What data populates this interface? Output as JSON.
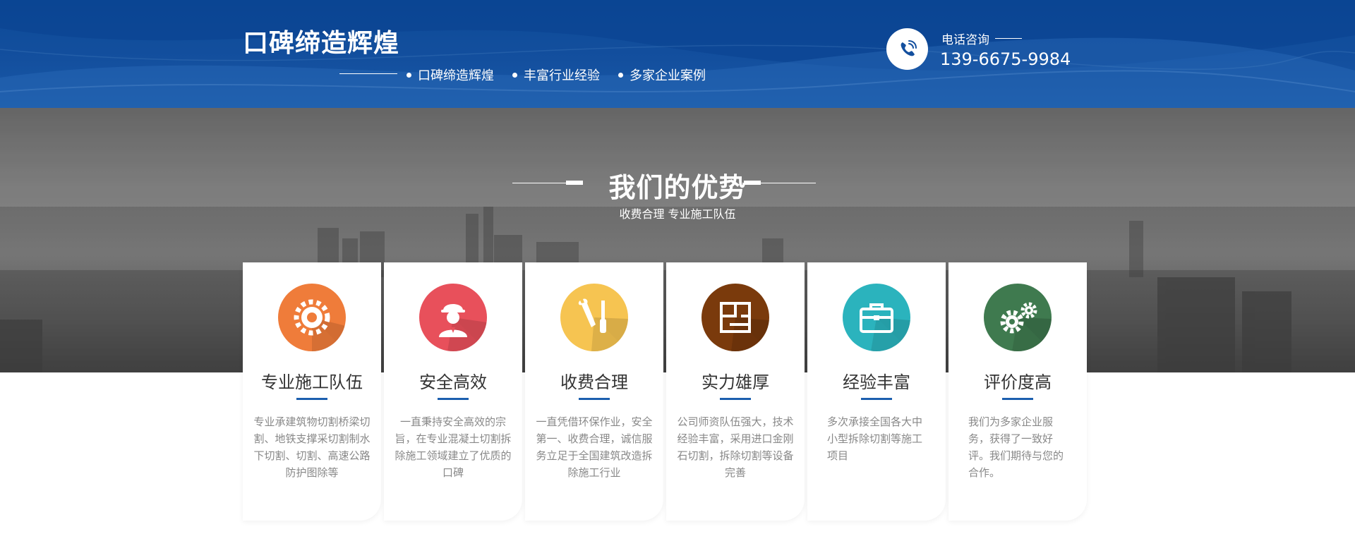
{
  "header": {
    "brand": "口碑缔造辉煌",
    "taglines": [
      "口碑缔造辉煌",
      "丰富行业经验",
      "多家企业案例"
    ],
    "phone_label": "电话咨询",
    "phone_number": "139-6675-9984",
    "phone_icon": "phone-icon"
  },
  "section": {
    "title": "我们的优势",
    "subtitle": "收费合理 专业施工队伍"
  },
  "cards": [
    {
      "title": "专业施工队伍",
      "desc": "专业承建筑物切割桥梁切割、地铁支撑采切割制水下切割、切割、高速公路防护图除等",
      "icon": "gear-icon",
      "color": "#ef7c3a"
    },
    {
      "title": "安全高效",
      "desc": "一直秉持安全高效的宗旨，在专业混凝土切割拆除施工领域建立了优质的口碑",
      "icon": "worker-helmet-icon",
      "color": "#e8505b"
    },
    {
      "title": "收费合理",
      "desc": "一直凭借环保作业，安全第一、收费合理，诚信服务立足于全国建筑改造拆除施工行业",
      "icon": "wrench-screwdriver-icon",
      "color": "#f6c451"
    },
    {
      "title": "实力雄厚",
      "desc": "公司师资队伍强大，技术经验丰富，采用进口金刚石切割，拆除切割等设备完善",
      "icon": "layout-icon",
      "color": "#7a3a0c"
    },
    {
      "title": "经验丰富",
      "desc": "多次承接全国各大中小型拆除切割等施工项目",
      "icon": "briefcase-icon",
      "color": "#2bb3bd"
    },
    {
      "title": "评价度高",
      "desc": "我们为多家企业服务，获得了一致好评。我们期待与您的合作。",
      "icon": "gears-icon",
      "color": "#3f7a4f"
    }
  ]
}
